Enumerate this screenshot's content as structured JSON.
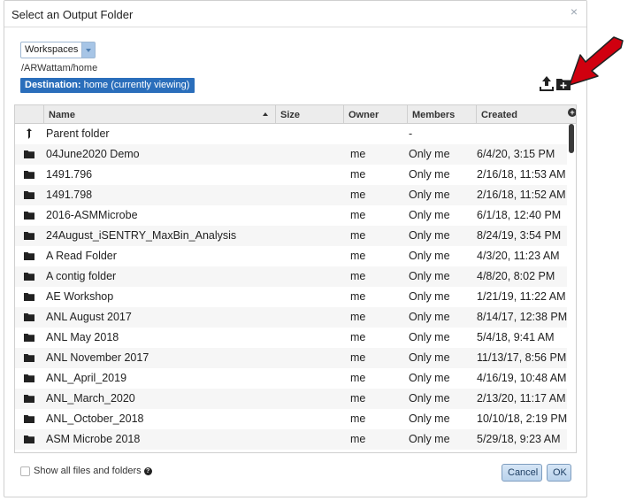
{
  "dialog": {
    "title": "Select an Output Folder",
    "close_glyph": "×"
  },
  "workspace_select": {
    "value": "Workspaces"
  },
  "path": "/ARWattam/home",
  "destination": {
    "label": "Destination:",
    "value": "home (currently viewing)"
  },
  "toolbar": {
    "upload_icon": "upload-icon",
    "new_folder_icon": "new-folder-icon"
  },
  "grid": {
    "columns": [
      "Name",
      "Size",
      "Owner",
      "Members",
      "Created"
    ],
    "add_column_glyph": "+",
    "rows": [
      {
        "icon": "parent-arrow-icon",
        "name": "Parent folder",
        "owner": "",
        "members": "-",
        "created": ""
      },
      {
        "icon": "folder-icon",
        "name": "04June2020 Demo",
        "owner": "me",
        "members": "Only me",
        "created": "6/4/20, 3:15 PM"
      },
      {
        "icon": "folder-icon",
        "name": "1491.796",
        "owner": "me",
        "members": "Only me",
        "created": "2/16/18, 11:53 AM"
      },
      {
        "icon": "folder-icon",
        "name": "1491.798",
        "owner": "me",
        "members": "Only me",
        "created": "2/16/18, 11:52 AM"
      },
      {
        "icon": "folder-icon",
        "name": "2016-ASMMicrobe",
        "owner": "me",
        "members": "Only me",
        "created": "6/1/18, 12:40 PM"
      },
      {
        "icon": "folder-icon",
        "name": "24August_iSENTRY_MaxBin_Analysis",
        "owner": "me",
        "members": "Only me",
        "created": "8/24/19, 3:54 PM"
      },
      {
        "icon": "folder-icon",
        "name": "A Read Folder",
        "owner": "me",
        "members": "Only me",
        "created": "4/3/20, 11:23 AM"
      },
      {
        "icon": "folder-icon",
        "name": "A contig folder",
        "owner": "me",
        "members": "Only me",
        "created": "4/8/20, 8:02 PM"
      },
      {
        "icon": "folder-icon",
        "name": "AE Workshop",
        "owner": "me",
        "members": "Only me",
        "created": "1/21/19, 11:22 AM"
      },
      {
        "icon": "folder-icon",
        "name": "ANL August 2017",
        "owner": "me",
        "members": "Only me",
        "created": "8/14/17, 12:38 PM"
      },
      {
        "icon": "folder-icon",
        "name": "ANL May 2018",
        "owner": "me",
        "members": "Only me",
        "created": "5/4/18, 9:41 AM"
      },
      {
        "icon": "folder-icon",
        "name": "ANL November 2017",
        "owner": "me",
        "members": "Only me",
        "created": "11/13/17, 8:56 PM"
      },
      {
        "icon": "folder-icon",
        "name": "ANL_April_2019",
        "owner": "me",
        "members": "Only me",
        "created": "4/16/19, 10:48 AM"
      },
      {
        "icon": "folder-icon",
        "name": "ANL_March_2020",
        "owner": "me",
        "members": "Only me",
        "created": "2/13/20, 11:17 AM"
      },
      {
        "icon": "folder-icon",
        "name": "ANL_October_2018",
        "owner": "me",
        "members": "Only me",
        "created": "10/10/18, 2:19 PM"
      },
      {
        "icon": "folder-icon",
        "name": "ASM Microbe 2018",
        "owner": "me",
        "members": "Only me",
        "created": "5/29/18, 9:23 AM"
      }
    ]
  },
  "footer": {
    "show_all_label": "Show all files and folders",
    "help_glyph": "?",
    "cancel_label": "Cancel",
    "ok_label": "OK"
  },
  "colors": {
    "destination_bg": "#2a6ebb",
    "button_bg": "#c6dcf2",
    "annotation_arrow": "#d0000f"
  }
}
